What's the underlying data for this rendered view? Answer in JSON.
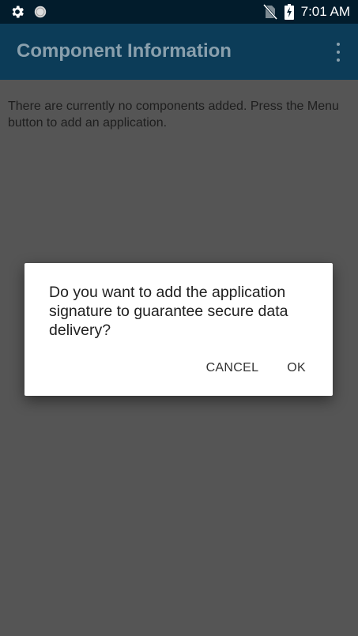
{
  "status_bar": {
    "time": "7:01 AM",
    "icons_left": [
      "gear-icon",
      "sync-icon"
    ],
    "icons_right": [
      "no-sim-icon",
      "battery-charging-icon"
    ]
  },
  "app_bar": {
    "title": "Component Information",
    "overflow_icon": "more-vert-icon"
  },
  "content": {
    "empty_message": "There are currently no components added. Press the Menu button to add an application."
  },
  "dialog": {
    "message": "Do you want to add the application signature to guarantee secure data delivery?",
    "cancel_label": "CANCEL",
    "ok_label": "OK"
  },
  "colors": {
    "status_bar": "#021c2c",
    "app_bar": "#0c3c58",
    "app_bar_text": "#8aa0ad",
    "scrim_background": "#555555",
    "dialog_background": "#ffffff"
  }
}
